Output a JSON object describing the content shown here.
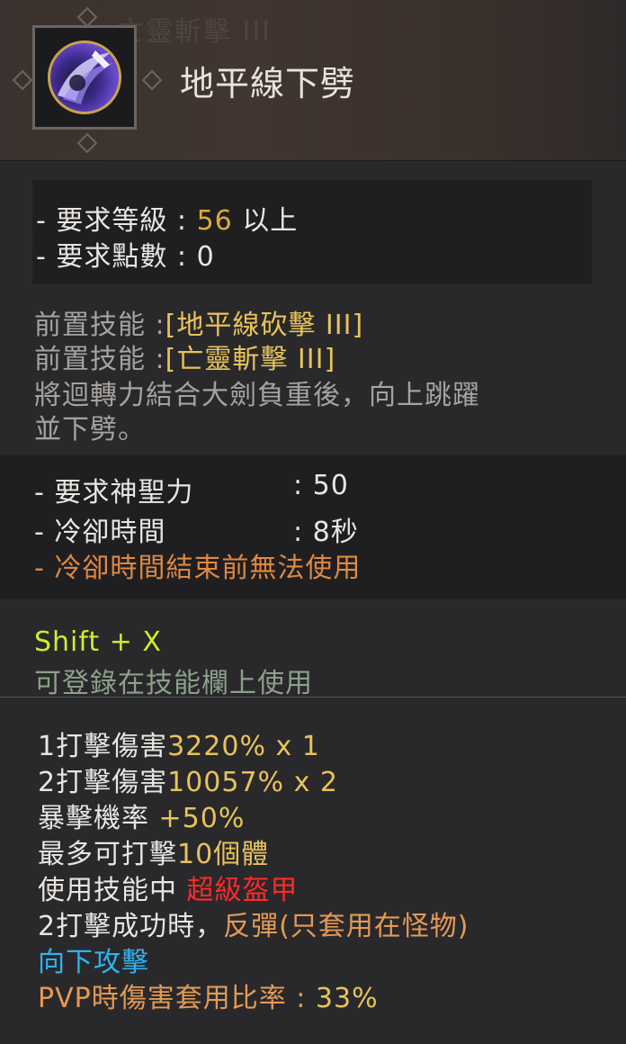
{
  "header": {
    "ghost_text": "亡靈斬擊 III",
    "icon": "sword-slash-skill-icon",
    "title": "地平線下劈"
  },
  "requirements": {
    "level_label": "- 要求等級 :",
    "level_value": "56",
    "level_suffix": "以上",
    "points_label": "- 要求點數 :",
    "points_value": "0"
  },
  "prerequisites": {
    "prereq1_label": "前置技能 :",
    "prereq1_value": "[地平線砍擊 III]",
    "prereq2_label": "前置技能 :",
    "prereq2_value": "[亡靈斬擊 III]",
    "description_line1": "將迴轉力結合大劍負重後，向上跳躍",
    "description_line2": "並下劈。"
  },
  "costs": {
    "divine_label": "- 要求神聖力",
    "divine_value": ": 50",
    "cooldown_label": "- 冷卻時間",
    "cooldown_value": ": 8秒",
    "cooldown_note": "- 冷卻時間結束前無法使用"
  },
  "hotkey": {
    "shortcut": "Shift + X",
    "note": "可登錄在技能欄上使用"
  },
  "stats": {
    "hit1_label": "1打擊傷害",
    "hit1_value": "3220% x 1",
    "hit2_label": "2打擊傷害",
    "hit2_value": "10057% x 2",
    "crit_label": "暴擊機率",
    "crit_value": "+50%",
    "max_label": "最多可打擊",
    "max_value": "10個體",
    "using_label": "使用技能中",
    "using_value": "超級盔甲",
    "success_label": "2打擊成功時，",
    "success_value": "反彈(只套用在怪物)",
    "down_attack": "向下攻擊",
    "pvp_label": "PVP時傷害套用比率 :",
    "pvp_value": "33%"
  },
  "colors": {
    "gold": "#e0a83a",
    "orange": "#e0883f",
    "hotkey_green": "#c8ef2e",
    "super_armor_red": "#ff2a2a",
    "down_attack_blue": "#2fb3f0"
  }
}
